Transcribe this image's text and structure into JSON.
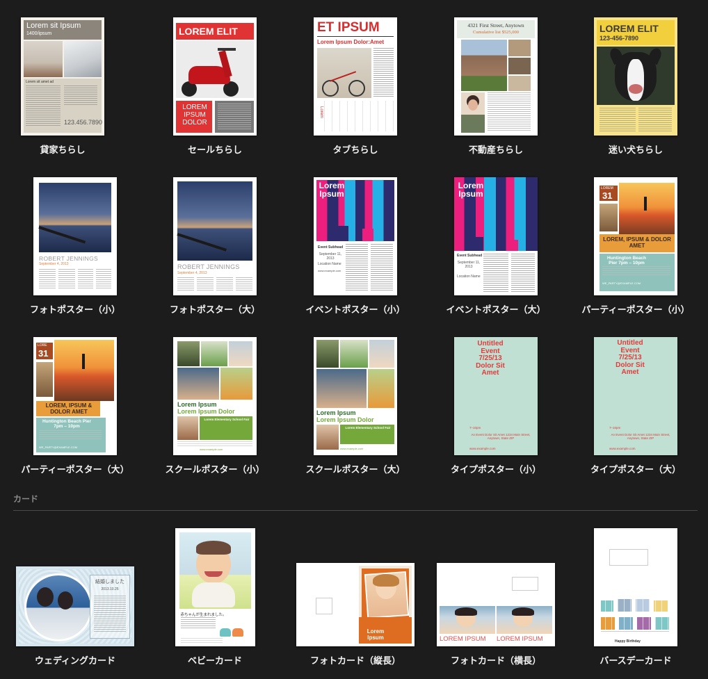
{
  "flyers": [
    {
      "label": "貸家ちらし",
      "thumb_title": "Lorem sit Ipsum",
      "thumb_sub": "1400/ipsum",
      "thumb_text": "Lorem sit amet ad",
      "thumb_phone": "123.456.7890"
    },
    {
      "label": "セールちらし",
      "thumb_title": "LOREM ELIT",
      "thumb_text": "LOREM IPSUM DOLOR"
    },
    {
      "label": "タブちらし",
      "thumb_title": "ET IPSUM",
      "thumb_sub": "Lorem Ipsum Dolor:Amet",
      "thumb_tab": "Lorem"
    },
    {
      "label": "不動産ちらし",
      "thumb_title": "4321 First Street, Anytown",
      "thumb_sub": "Cumulative list $525,000"
    },
    {
      "label": "迷い犬ちらし",
      "thumb_title": "LOREM ELIT",
      "thumb_sub": "123-456-7890"
    }
  ],
  "posters_row1": [
    {
      "label": "フォトポスター（小）",
      "thumb_title": "ROBERT JENNINGS",
      "thumb_sub": "September 4, 2013"
    },
    {
      "label": "フォトポスター（大）",
      "thumb_title": "ROBERT JENNINGS",
      "thumb_sub": "September 4, 2013"
    },
    {
      "label": "イベントポスター（小）",
      "thumb_title": "Lorem Ipsum",
      "thumb_sub": "Event Subhead",
      "thumb_date": "September 11, 2013",
      "thumb_loc": "Location Name",
      "thumb_url": "www.example.com"
    },
    {
      "label": "イベントポスター（大）",
      "thumb_title": "Lorem Ipsum",
      "thumb_sub": "Event Subhead",
      "thumb_date": "September 11, 2013",
      "thumb_loc": "Location Name"
    },
    {
      "label": "パーティーポスター（小）",
      "thumb_badge_top": "LOREM",
      "thumb_badge_num": "31",
      "thumb_title": "LOREM, IPSUM & DOLOR AMET",
      "thumb_sub": "Huntington Beach Pier 7pm – 10pm",
      "thumb_url": "WE_PARTY@EXAMPLE.COM"
    }
  ],
  "posters_row2": [
    {
      "label": "パーティーポスター（大）",
      "thumb_badge_top": "LORE",
      "thumb_badge_num": "31",
      "thumb_title": "LOREM, IPSUM & DOLOR AMET",
      "thumb_sub": "Huntington Beach Pier 7pm – 10pm",
      "thumb_url": "WE_PARTY@EXAMPLE.COM"
    },
    {
      "label": "スクールポスター（小）",
      "thumb_title": "Lorem Ipsum",
      "thumb_sub": "Lorem Ipsum Dolor",
      "thumb_text": "Lorem Elementary School Fair",
      "thumb_url": "www.example.com"
    },
    {
      "label": "スクールポスター（大）",
      "thumb_title": "Lorem Ipsum",
      "thumb_sub": "Lorem Ipsum Dolor",
      "thumb_text": "Lorem Elementary School Fair",
      "thumb_url": "www.example.com"
    },
    {
      "label": "タイプポスター（小）",
      "thumb_title": "Untitled Event 7/25/13 Dolor Sit Amet",
      "thumb_time": "7–10pm",
      "thumb_addr": "An Event Dolor Sit Amet 1234 Main Street, Anytown, State ZIP",
      "thumb_url": "www.example.com"
    },
    {
      "label": "タイプポスター（大）",
      "thumb_title": "Untitled Event 7/25/13 Dolor Sit Amet",
      "thumb_time": "7–10pm",
      "thumb_addr": "An Event Dolor Sit Amet 1234 Main Street, Anytown, State ZIP",
      "thumb_url": "www.example.com"
    }
  ],
  "cards_section": {
    "title": "カード"
  },
  "cards": [
    {
      "label": "ウェディングカード",
      "thumb_title": "結婚しました",
      "thumb_date": "2013.10.25"
    },
    {
      "label": "ベビーカード",
      "thumb_title": "赤ちゃんが生まれました。"
    },
    {
      "label": "フォトカード（縦長）",
      "thumb_title": "Lorem Ipsum"
    },
    {
      "label": "フォトカード（横長）",
      "thumb_title": "LOREM IPSUM"
    },
    {
      "label": "バースデーカード",
      "thumb_title": "Happy Birthday"
    }
  ],
  "colors": {
    "background": "#1c1c1c",
    "divider": "#4a4a4a",
    "section_text": "#8a8a8a",
    "label_text": "#f2f2f2",
    "sale_red": "#e03333",
    "tab_red": "#d62e2e",
    "dog_yellow": "#f2cf3c",
    "party_orange": "#e99c3a",
    "party_teal": "#8fc2bb",
    "school_green": "#74a83b",
    "type_mint": "#bfe0d2",
    "type_red": "#e23b3b",
    "photocard_orange": "#de6d22"
  }
}
